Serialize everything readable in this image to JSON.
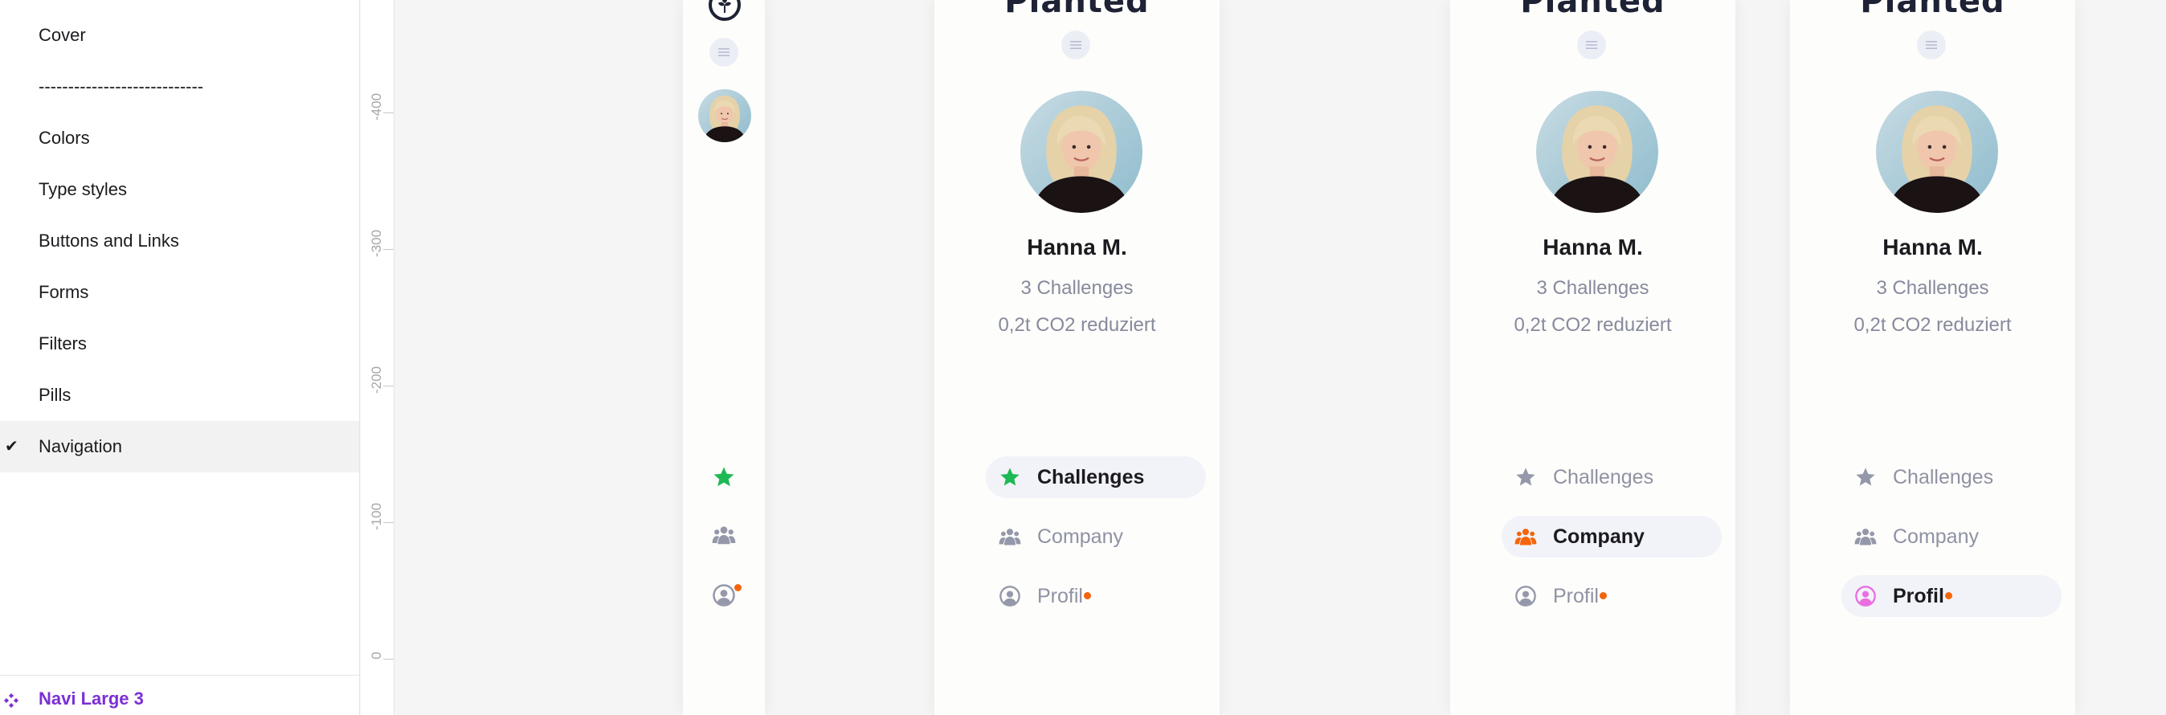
{
  "pages_panel": {
    "items": [
      {
        "label": "Cover"
      },
      {
        "label": "----------------------------"
      },
      {
        "label": "Colors"
      },
      {
        "label": "Type styles"
      },
      {
        "label": "Buttons and Links"
      },
      {
        "label": "Forms"
      },
      {
        "label": "Filters"
      },
      {
        "label": "Pills"
      },
      {
        "label": "Navigation",
        "checkmark": "✔"
      }
    ],
    "current_component": "Navi Large 3"
  },
  "ruler": {
    "labels": [
      "-400",
      "-300",
      "-200",
      "-100",
      "0"
    ]
  },
  "colors": {
    "accent_green": "#1db954",
    "accent_orange": "#f4650b",
    "accent_pink": "#e96ee0",
    "muted_icon": "#9598aa",
    "component_purple": "#7b2fd4"
  },
  "profile": {
    "name": "Hanna M.",
    "challenges_count": "3 Challenges",
    "co2": "0,2t CO2 reduziert"
  },
  "logo": {
    "text": "Planted"
  },
  "nav": {
    "challenges": "Challenges",
    "company": "Company",
    "profil": "Profil"
  },
  "frames": [
    {
      "variant": "compact-rail",
      "active": "challenges"
    },
    {
      "variant": "large",
      "active": "challenges"
    },
    {
      "variant": "large",
      "active": "company"
    },
    {
      "variant": "large",
      "active": "profil"
    }
  ]
}
